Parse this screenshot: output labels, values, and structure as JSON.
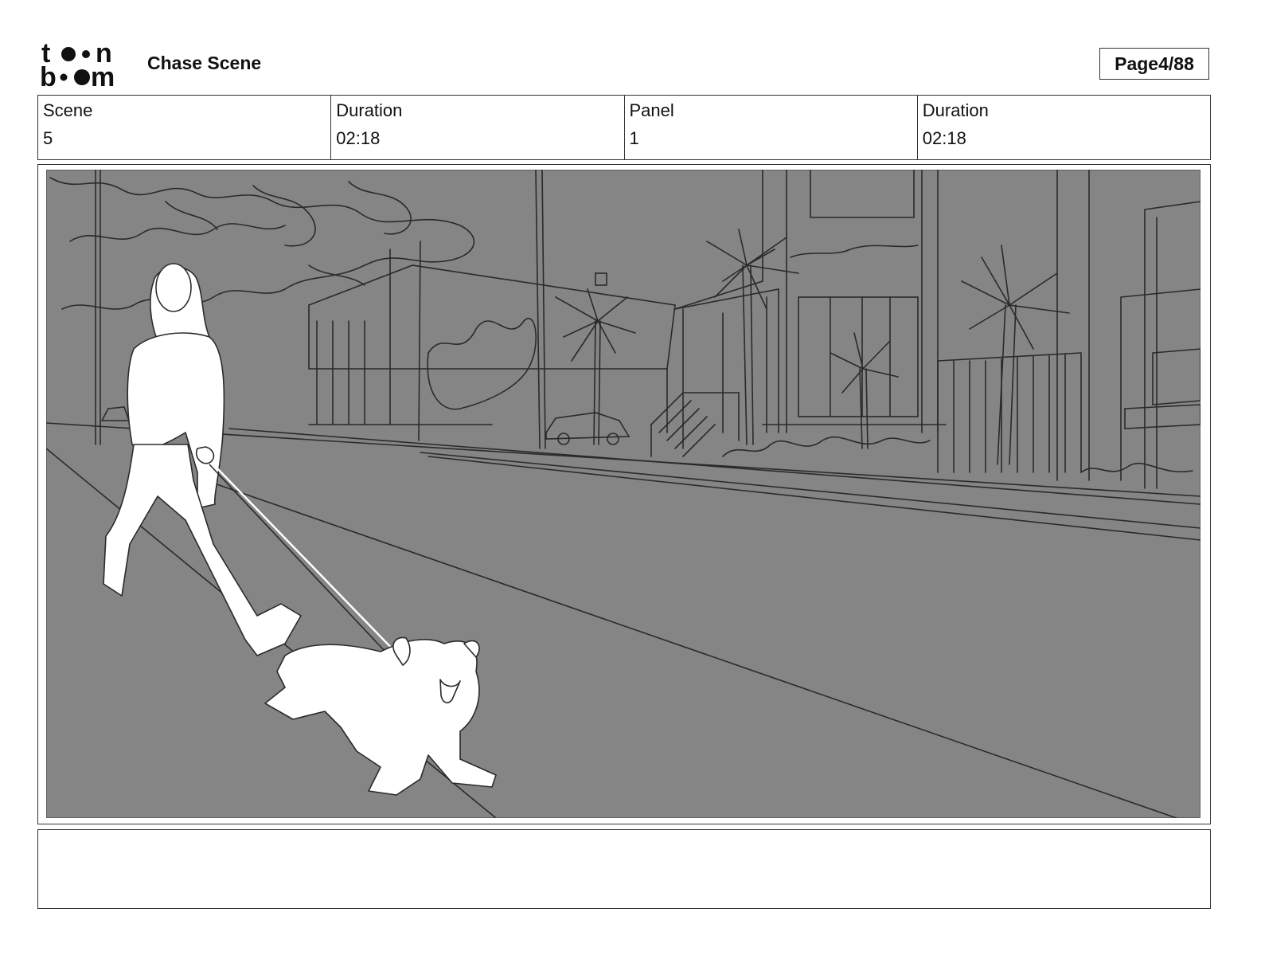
{
  "header": {
    "logo_text": "toonboom",
    "title": "Chase Scene",
    "page_label": "Page",
    "page_number": "4/88"
  },
  "info": {
    "scene_label": "Scene",
    "scene_value": "5",
    "scene_duration_label": "Duration",
    "scene_duration_value": "02:18",
    "panel_label": "Panel",
    "panel_value": "1",
    "panel_duration_label": "Duration",
    "panel_duration_value": "02:18"
  },
  "notes": {
    "text": ""
  },
  "colors": {
    "panel_background": "#858585",
    "sketch_line": "#2a2a2a",
    "character_fill": "#ffffff"
  }
}
